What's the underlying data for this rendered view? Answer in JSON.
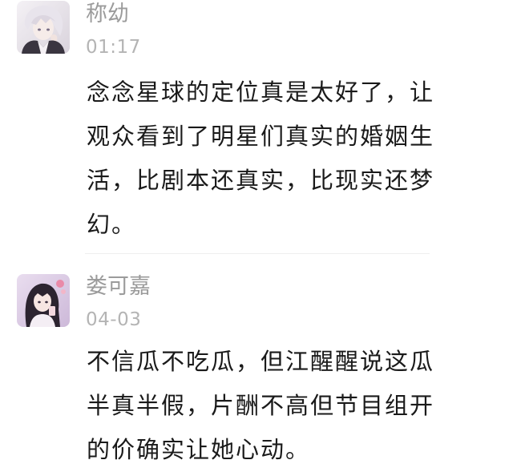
{
  "comments": [
    {
      "username": "称幼",
      "time": "01:17",
      "lines": [
        "念念星球的定位真是太好了，让",
        "观众看到了明星们真实的婚姻生",
        "活，比剧本还真实，比现实还梦",
        "幻。"
      ]
    },
    {
      "username": "娄可嘉",
      "time": "04-03",
      "lines": [
        "不信瓜不吃瓜，但江醒醒说这瓜",
        "半真半假，片酬不高但节目组开",
        "的价确实让她心动。"
      ]
    }
  ]
}
